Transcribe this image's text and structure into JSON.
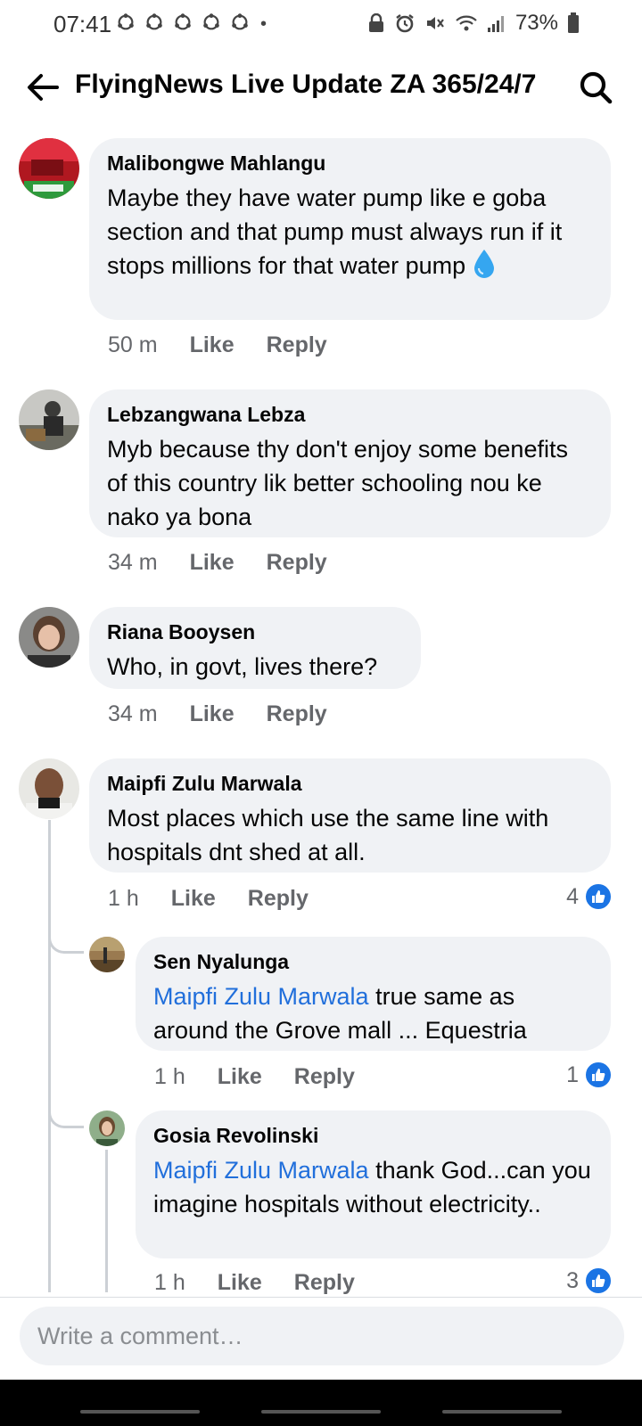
{
  "status_bar": {
    "time": "07:41",
    "notification_icons": [
      "app-notification-icon",
      "app-notification-icon",
      "app-notification-icon",
      "app-notification-icon",
      "app-notification-icon"
    ],
    "dot": "•",
    "battery": "73%"
  },
  "header": {
    "title": "FlyingNews Live Update ZA 365/24/7"
  },
  "comments": [
    {
      "author": "Malibongwe Mahlangu",
      "text": "Maybe they have water pump like  e goba section and that pump must always run if it stops millions for that water pump",
      "time": "50 m",
      "like": "Like",
      "reply": "Reply"
    },
    {
      "author": "Lebzangwana Lebza",
      "text": "Myb because thy don't enjoy some benefits of this country lik better schooling nou ke nako ya bona",
      "time": "34 m",
      "like": "Like",
      "reply": "Reply"
    },
    {
      "author": "Riana Booysen",
      "text": "Who, in govt, lives there?",
      "time": "34 m",
      "like": "Like",
      "reply": "Reply"
    },
    {
      "author": "Maipfi Zulu Marwala",
      "text": "Most places which use the same line with hospitals dnt shed at all.",
      "time": "1 h",
      "like": "Like",
      "reply": "Reply",
      "reactions": "4",
      "replies": [
        {
          "author": "Sen Nyalunga",
          "mention": "Maipfi Zulu Marwala",
          "text": " true same as around the Grove mall ... Equestria",
          "time": "1 h",
          "like": "Like",
          "reply": "Reply",
          "reactions": "1"
        },
        {
          "author": "Gosia Revolinski",
          "mention": "Maipfi Zulu Marwala",
          "text": " thank God...can you imagine hospitals without electricity..",
          "time": "1 h",
          "like": "Like",
          "reply": "Reply",
          "reactions": "3"
        }
      ]
    }
  ],
  "composer": {
    "placeholder": "Write a comment…"
  },
  "colors": {
    "bubble": "#f0f2f5",
    "mention": "#216fdb",
    "like_badge": "#1b74e4",
    "secondary_text": "#65676b"
  }
}
